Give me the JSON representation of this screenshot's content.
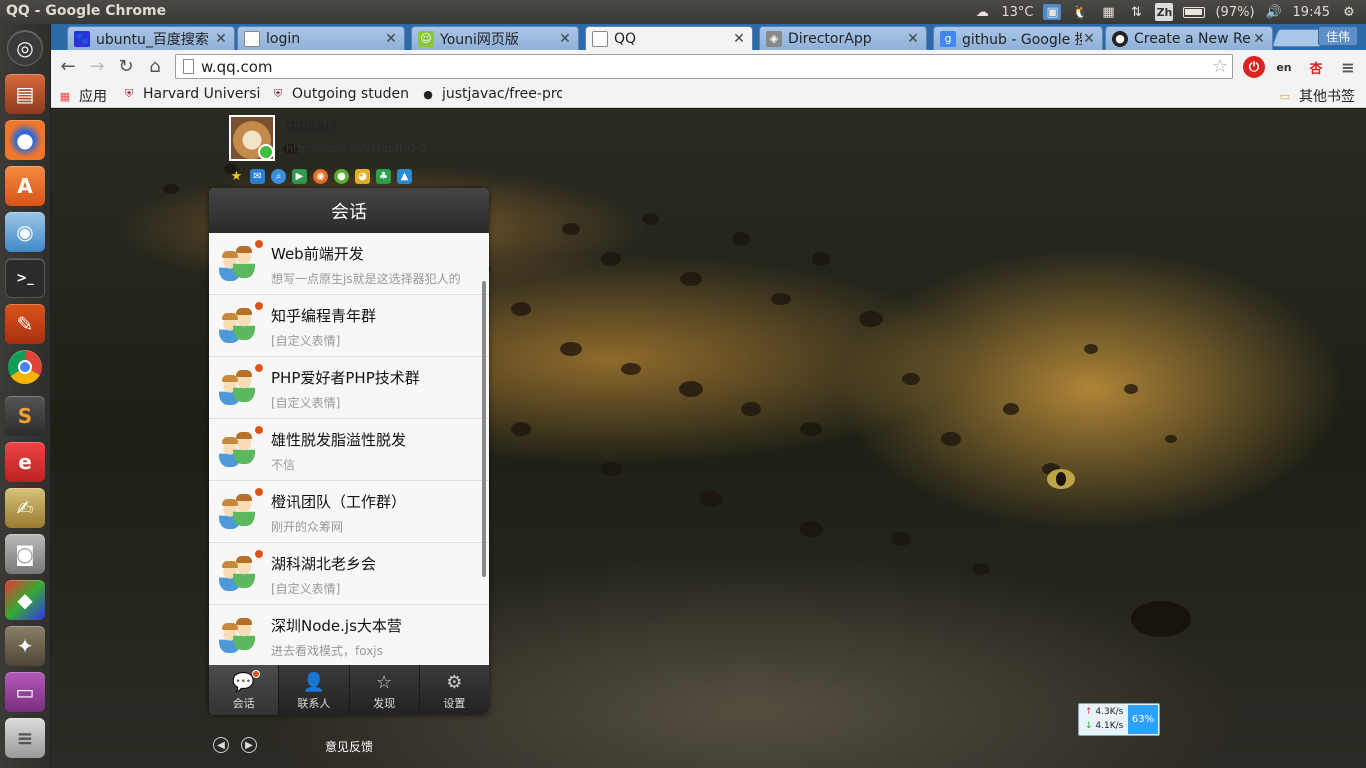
{
  "window": {
    "title": "QQ - Google Chrome"
  },
  "tray": {
    "temperature": "13°C",
    "input_method": "Zh",
    "battery": "(97%)",
    "time": "19:45"
  },
  "launcher": {
    "items": [
      "dash",
      "files",
      "firefox",
      "software-center",
      "update-manager",
      "terminal",
      "system-settings",
      "chrome",
      "sublime-text",
      "ebook-reader",
      "text-editor",
      "camera",
      "3d-app",
      "gimp",
      "media-player",
      "workspaces",
      "trash"
    ]
  },
  "tabs": [
    {
      "label": "ubuntu_百度搜索",
      "icon": "baidu-icon"
    },
    {
      "label": "login",
      "icon": "page-icon"
    },
    {
      "label": "Youni网页版",
      "icon": "youni-icon"
    },
    {
      "label": "QQ",
      "icon": "page-icon",
      "active": true
    },
    {
      "label": "DirectorApp",
      "icon": "app-icon"
    },
    {
      "label": "github - Google 搜",
      "icon": "google-icon"
    },
    {
      "label": "Create a New Rep",
      "icon": "github-icon"
    }
  ],
  "profile_button": "佳伟",
  "toolbar": {
    "url": "w.qq.com"
  },
  "bookmarks": [
    {
      "label": "应用",
      "icon": "apps-grid-icon"
    },
    {
      "label": "Harvard Universi",
      "icon": "harvard-shield-icon"
    },
    {
      "label": "Outgoing studen",
      "icon": "harvard-shield-icon"
    },
    {
      "label": "justjavac/free-pro",
      "icon": "github-icon"
    }
  ],
  "other_bookmarks": "其他书签",
  "qq": {
    "nickname": "gglinux",
    "signature": "http://honx.in/VMnpfUQ-2...",
    "header_title": "会话",
    "conversations": [
      {
        "name": "Web前端开发",
        "last_message": "想写一点原生js就是这选择器犯人的",
        "unread": true
      },
      {
        "name": "知乎编程青年群",
        "last_message": "[自定义表情]",
        "unread": true
      },
      {
        "name": "PHP爱好者PHP技术群",
        "last_message": "[自定义表情]",
        "unread": true
      },
      {
        "name": "雄性脱发脂溢性脱发",
        "last_message": "不信",
        "unread": true
      },
      {
        "name": "橙讯团队（工作群）",
        "last_message": "刚开的众筹网",
        "unread": true
      },
      {
        "name": "湖科湖北老乡会",
        "last_message": "[自定义表情]",
        "unread": true
      },
      {
        "name": "深圳Node.js大本营",
        "last_message": "进去看戏模式，foxjs",
        "unread": false
      }
    ],
    "tabbar": [
      {
        "label": "会话",
        "icon": "chat-bubble-icon",
        "active": true
      },
      {
        "label": "联系人",
        "icon": "contact-person-icon"
      },
      {
        "label": "发现",
        "icon": "discover-star-icon"
      },
      {
        "label": "设置",
        "icon": "gear-icon"
      }
    ],
    "feedback": "意见反馈"
  },
  "netspeed": {
    "upload": "4.3K/s",
    "download": "4.1K/s",
    "percent": "63%"
  },
  "colors": {
    "tab_strip": "#2c6ba8",
    "qq_header": "#333333",
    "unread_dot": "#e0541c",
    "active_tab_icon": "#4aa3f0"
  }
}
